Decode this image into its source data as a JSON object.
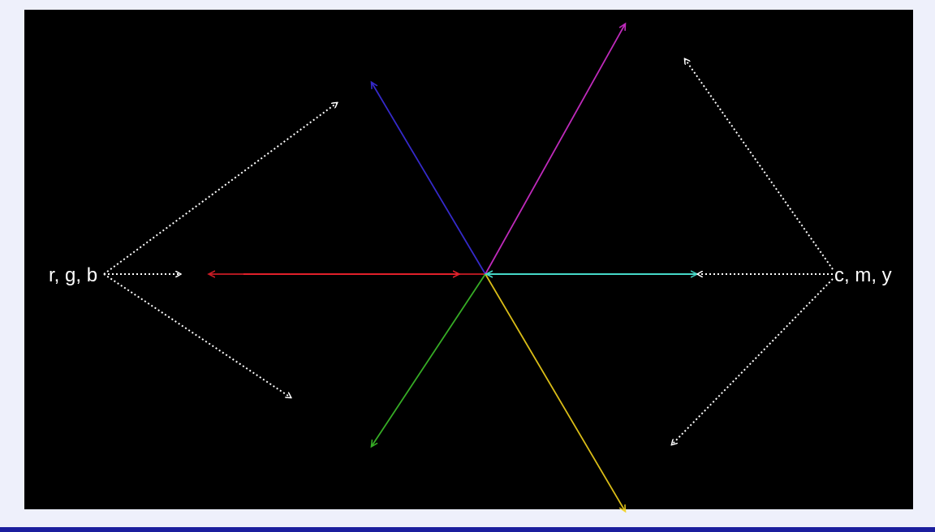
{
  "labels": {
    "left": "r, g, b",
    "right": "c, m, y"
  },
  "colors": {
    "background": "#000000",
    "frame": "#eef0fb",
    "bottom_bar": "#1b1e9e",
    "annotation": "#ffffff",
    "red": "#e0202a",
    "green": "#3cbf2a",
    "blue": "#3b2fe0",
    "cyan": "#46d8c8",
    "magenta": "#d42fd0",
    "yellow": "#f2d21a"
  }
}
